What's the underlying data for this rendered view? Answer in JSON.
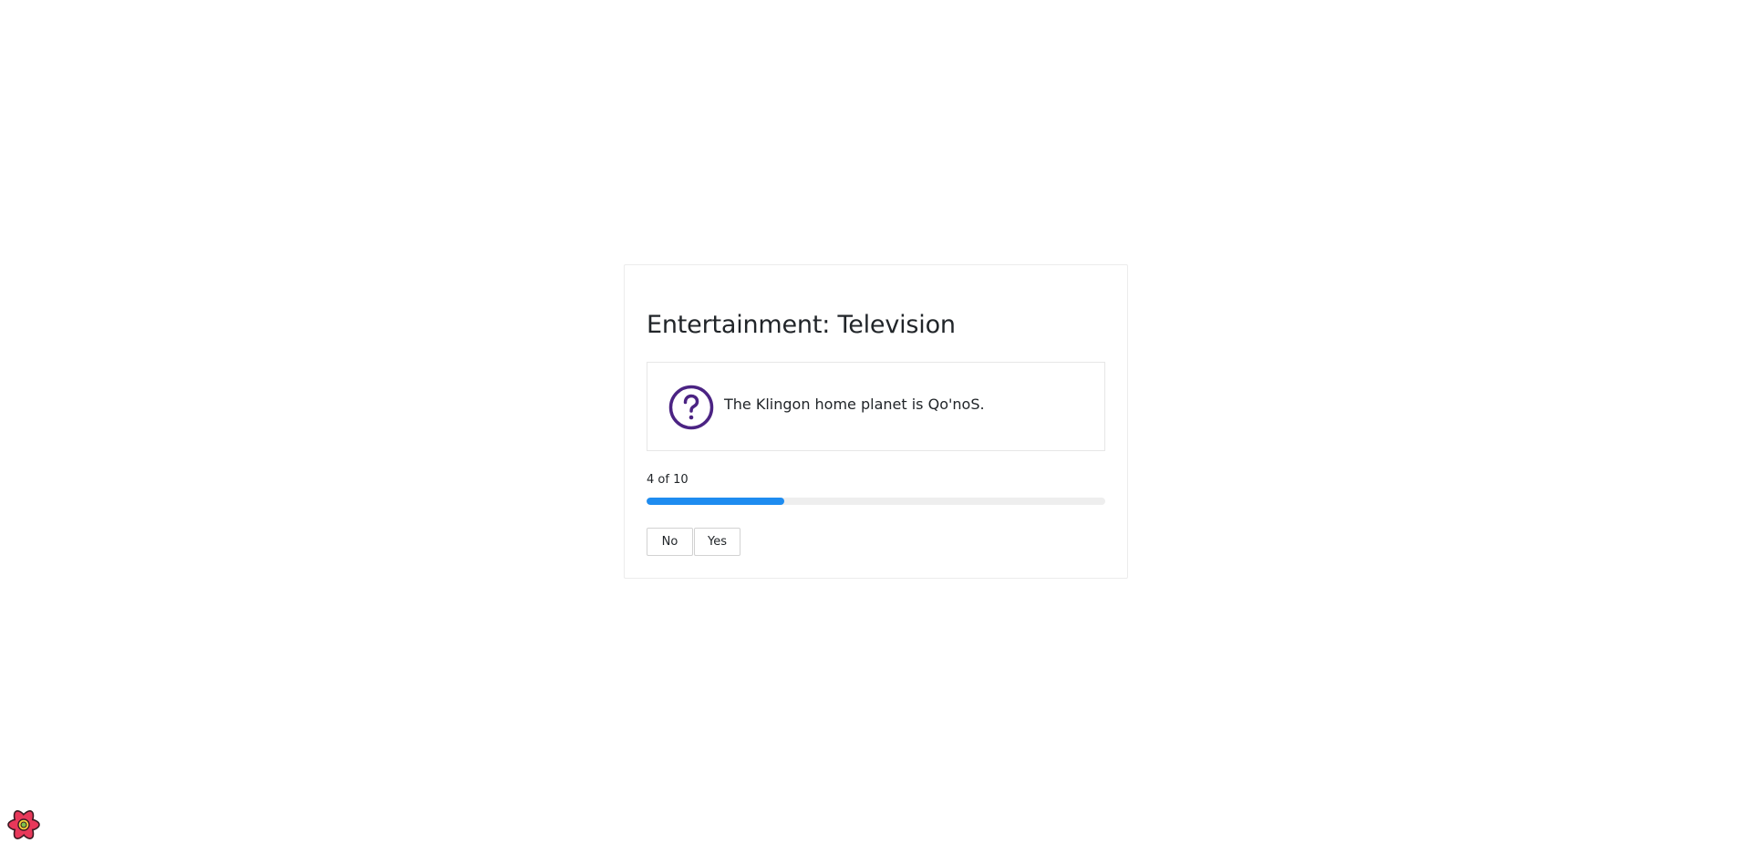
{
  "quiz": {
    "category": "Entertainment: Television",
    "question": "The Klingon home planet is Qo'noS.",
    "question_icon": "question-circle-icon",
    "progress_label": "4 of 10",
    "progress_fraction": 0.3,
    "progress_color": "#1e8cf0",
    "icon_color": "#4b2383",
    "answers": {
      "no_label": "No",
      "yes_label": "Yes"
    }
  },
  "corner_logo": {
    "icon": "react-devtools-logo-icon",
    "color": "#e8385a"
  }
}
